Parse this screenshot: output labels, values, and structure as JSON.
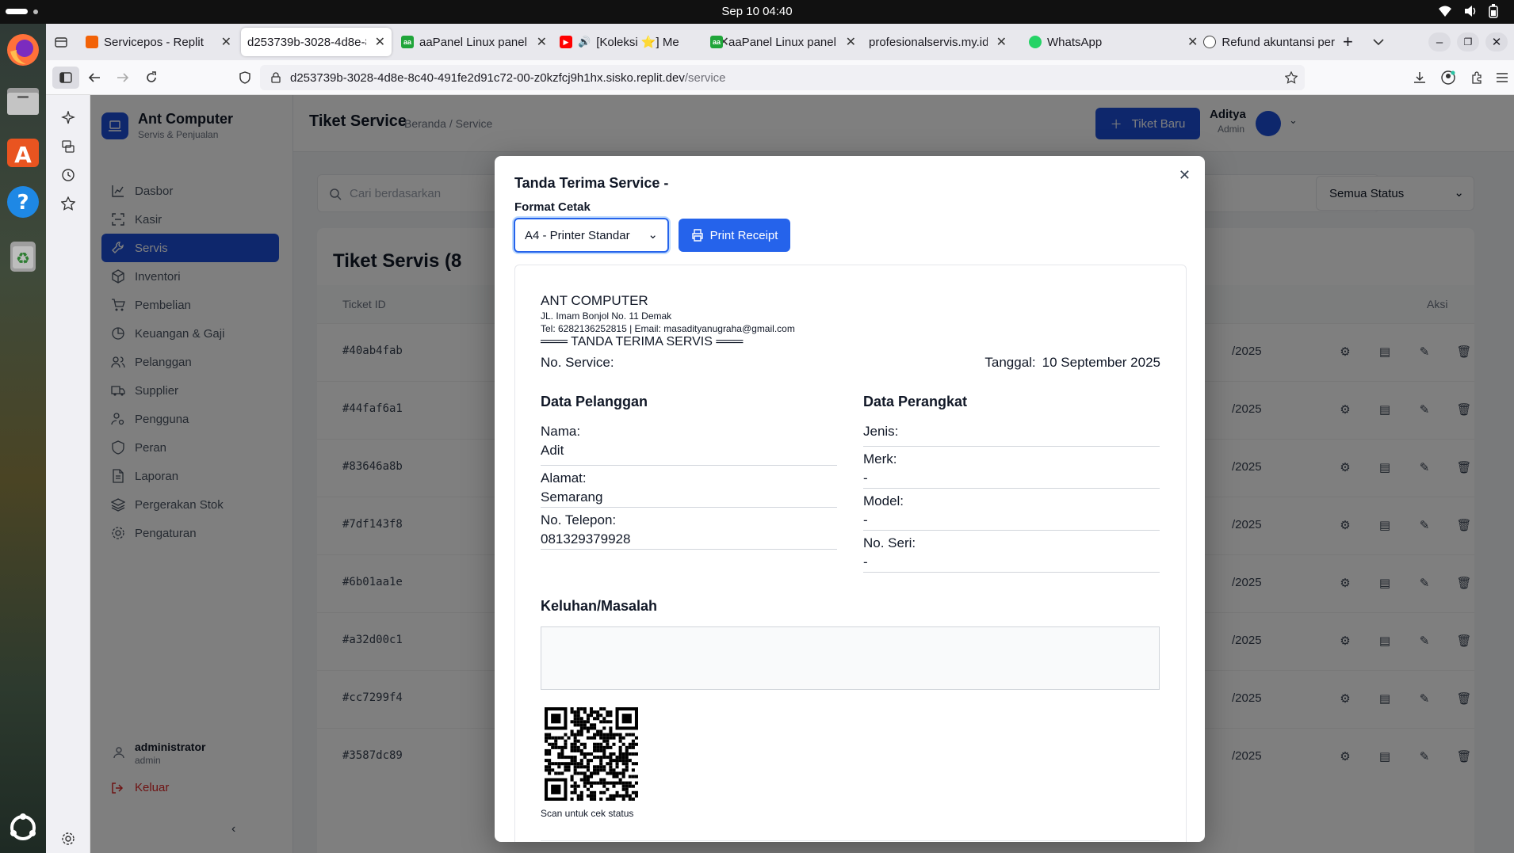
{
  "system": {
    "clock": "Sep 10  04:40"
  },
  "browser": {
    "tabs": [
      {
        "label": "Servicepos - Replit",
        "favicon": "replit"
      },
      {
        "label": "d253739b-3028-4d8e-8c",
        "favicon": "none",
        "active": true
      },
      {
        "label": "aaPanel Linux panel",
        "favicon": "aapanel"
      },
      {
        "label": "[Koleksi ⭐] Me",
        "favicon": "youtube"
      },
      {
        "label": "aaPanel Linux panel",
        "favicon": "aapanel"
      },
      {
        "label": "profesionalservis.my.id |",
        "favicon": "none"
      },
      {
        "label": "WhatsApp",
        "favicon": "whatsapp"
      },
      {
        "label": "Refund akuntansi per",
        "favicon": "openai"
      }
    ],
    "url_host": "d253739b-3028-4d8e-8c40-491fe2d91c72-00-z0kzfcj9h1hx.sisko.replit.dev",
    "url_path": "/service"
  },
  "app": {
    "brand": "Ant Computer",
    "brand_sub": "Servis & Penjualan",
    "menu": [
      {
        "label": "Dasbor",
        "icon": "chart-line-icon"
      },
      {
        "label": "Kasir",
        "icon": "scan-icon"
      },
      {
        "label": "Servis",
        "icon": "wrench-icon",
        "active": true
      },
      {
        "label": "Inventori",
        "icon": "box-icon"
      },
      {
        "label": "Pembelian",
        "icon": "cart-icon"
      },
      {
        "label": "Keuangan & Gaji",
        "icon": "pie-chart-icon"
      },
      {
        "label": "Pelanggan",
        "icon": "users-icon"
      },
      {
        "label": "Supplier",
        "icon": "truck-icon"
      },
      {
        "label": "Pengguna",
        "icon": "user-cog-icon"
      },
      {
        "label": "Peran",
        "icon": "shield-icon"
      },
      {
        "label": "Laporan",
        "icon": "file-icon"
      },
      {
        "label": "Pergerakan Stok",
        "icon": "layers-icon"
      },
      {
        "label": "Pengaturan",
        "icon": "gear-icon"
      }
    ],
    "footer_user": "administrator",
    "footer_role": "admin",
    "logout": "Keluar",
    "page_title": "Tiket Service",
    "breadcrumb": "Beranda / Service",
    "new_ticket": "Tiket Baru",
    "user_name": "Aditya",
    "user_role": "Admin",
    "search_placeholder": "Cari berdasarkan",
    "status_filter": "Semua Status",
    "table_title": "Tiket Servis (8",
    "col_ticket": "Ticket ID",
    "col_action": "Aksi",
    "rows": [
      {
        "id": "#40ab4fab",
        "date": "/2025"
      },
      {
        "id": "#44faf6a1",
        "date": "/2025"
      },
      {
        "id": "#83646a8b",
        "date": "/2025"
      },
      {
        "id": "#7df143f8",
        "date": "/2025"
      },
      {
        "id": "#6b01aa1e",
        "date": "/2025"
      },
      {
        "id": "#a32d00c1",
        "date": "/2025"
      },
      {
        "id": "#cc7299f4",
        "date": "/2025"
      },
      {
        "id": "#3587dc89",
        "date": "/2025"
      }
    ]
  },
  "modal": {
    "title": "Tanda Terima Service -",
    "format_label": "Format Cetak",
    "format_value": "A4 - Printer Standar",
    "print_button": "Print Receipt",
    "receipt": {
      "company": "ANT COMPUTER",
      "address": "JL. Imam Bonjol No. 11 Demak",
      "contact": "Tel: 6282136252815 | Email: masadityanugraha@gmail.com",
      "heading": "═══ TANDA TERIMA SERVIS ═══",
      "no_service_label": "No. Service:",
      "date_label": "Tanggal:",
      "date_value": "10 September 2025",
      "customer_title": "Data Pelanggan",
      "device_title": "Data Perangkat",
      "customer": [
        {
          "label": "Nama:",
          "value": "Adit"
        },
        {
          "label": "Alamat:",
          "value": "Semarang"
        },
        {
          "label": "No. Telepon:",
          "value": "081329379928"
        }
      ],
      "device": [
        {
          "label": "Jenis:",
          "value": ""
        },
        {
          "label": "Merk:",
          "value": "-"
        },
        {
          "label": "Model:",
          "value": "-"
        },
        {
          "label": "No. Seri:",
          "value": "-"
        }
      ],
      "complaint_title": "Keluhan/Masalah",
      "complaint": "",
      "qr_caption": "Scan untuk cek status"
    }
  },
  "colors": {
    "primary": "#1d4ed8",
    "button": "#2563eb",
    "dark": "#111827"
  }
}
